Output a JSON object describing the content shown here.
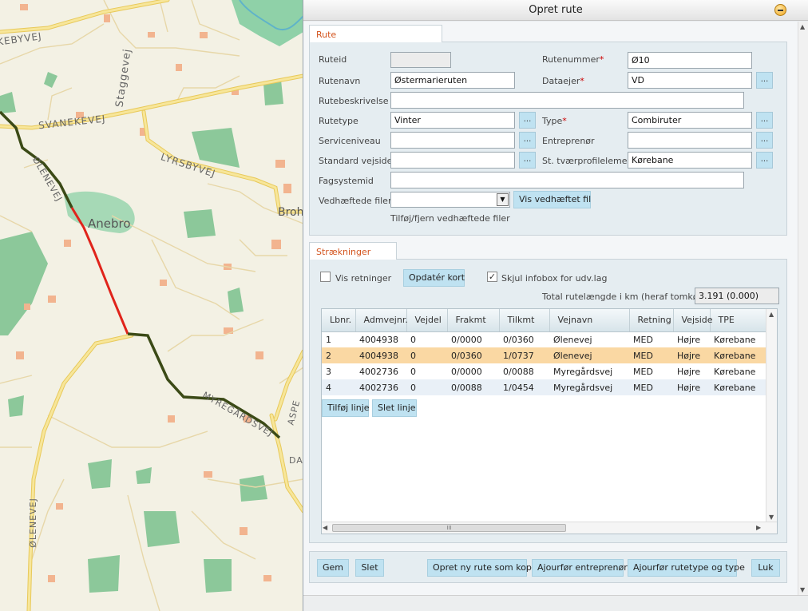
{
  "window": {
    "title": "Opret rute"
  },
  "map": {
    "labels": {
      "kebbyvej": "KEBYVEJ",
      "staggevej": "Staggevej",
      "svanekevej": "SVANEKEVEJ",
      "lyrsbyvej": "LYRSBYVEJ",
      "olenevej_top": "ØLENEVEJ",
      "anebro": "Anebro",
      "broh": "Broh",
      "myregardsvej": "MYREGÅRDSVEJ",
      "aspe": "ASPE",
      "da": "DA",
      "olenevej_bottom": "ØLENEVEJ"
    }
  },
  "rute": {
    "tab": "Rute",
    "ruteid": {
      "label": "Ruteid",
      "value": ""
    },
    "rutenummer": {
      "label": "Rutenummer",
      "value": "Ø10"
    },
    "rutenavn": {
      "label": "Rutenavn",
      "value": "Østermarieruten"
    },
    "dataejer": {
      "label": "Dataejer",
      "value": "VD"
    },
    "rutebeskrivelse": {
      "label": "Rutebeskrivelse",
      "value": ""
    },
    "rutetype": {
      "label": "Rutetype",
      "value": "Vinter"
    },
    "type": {
      "label": "Type",
      "value": "Combiruter"
    },
    "serviceniveau": {
      "label": "Serviceniveau",
      "value": ""
    },
    "entreprenor": {
      "label": "Entreprenør",
      "value": ""
    },
    "standard_vejside": {
      "label": "Standard vejside",
      "value": ""
    },
    "st_tvaerprofil": {
      "label": "St. tværprofilelement",
      "value": "Kørebane"
    },
    "fagsystemid": {
      "label": "Fagsystemid",
      "value": ""
    },
    "vedhaeftede": {
      "label": "Vedhæftede filer:",
      "value": "",
      "button": "Vis vedhæftet fil",
      "link": "Tilføj/fjern vedhæftede filer"
    },
    "dots": "...",
    "required_mark": "*"
  },
  "straekninger": {
    "tab": "Strækninger",
    "vis_retninger": {
      "label": "Vis retninger",
      "checked": false
    },
    "opdater_kort": "Opdatér kort",
    "skjul_infobox": {
      "label": "Skjul infobox for udv.lag",
      "checked": true
    },
    "total_label": "Total rutelængde i km (heraf tomkørsel)",
    "total_value": "3.191 (0.000)",
    "columns": [
      "Lbnr.",
      "Admvejnr.",
      "Vejdel",
      "Frakmt",
      "Tilkmt",
      "Vejnavn",
      "Retning",
      "Vejside",
      "TPE"
    ],
    "rows": [
      {
        "lbnr": "1",
        "admvejnr": "4004938",
        "vejdel": "0",
        "frakmt": "0/0000",
        "tilkmt": "0/0360",
        "vejnavn": "Ølenevej",
        "retning": "MED",
        "vejside": "Højre",
        "tpe": "Kørebane"
      },
      {
        "lbnr": "2",
        "admvejnr": "4004938",
        "vejdel": "0",
        "frakmt": "0/0360",
        "tilkmt": "1/0737",
        "vejnavn": "Ølenevej",
        "retning": "MED",
        "vejside": "Højre",
        "tpe": "Kørebane"
      },
      {
        "lbnr": "3",
        "admvejnr": "4002736",
        "vejdel": "0",
        "frakmt": "0/0000",
        "tilkmt": "0/0088",
        "vejnavn": "Myregårdsvej",
        "retning": "MED",
        "vejside": "Højre",
        "tpe": "Kørebane"
      },
      {
        "lbnr": "4",
        "admvejnr": "4002736",
        "vejdel": "0",
        "frakmt": "0/0088",
        "tilkmt": "1/0454",
        "vejnavn": "Myregårdsvej",
        "retning": "MED",
        "vejside": "Højre",
        "tpe": "Kørebane"
      }
    ],
    "selected_row": 2,
    "tilfoj_linje": "Tilføj linje",
    "slet_linje": "Slet linje",
    "scroll_thumb": "III"
  },
  "footer": {
    "gem": "Gem",
    "slet": "Slet",
    "opret_kopi": "Opret ny rute som kopi",
    "ajourfor_entreprenor": "Ajourfør entreprenør",
    "ajourfor_rutetype": "Ajourfør rutetype og type",
    "luk": "Luk"
  },
  "colors": {
    "tab_text": "#d3541e",
    "button_bg": "#bfe2f1",
    "selected_row": "#fad8a3",
    "route_red": "#e0241b",
    "route_dark": "#3b4a16",
    "road": "#f3d66a"
  }
}
